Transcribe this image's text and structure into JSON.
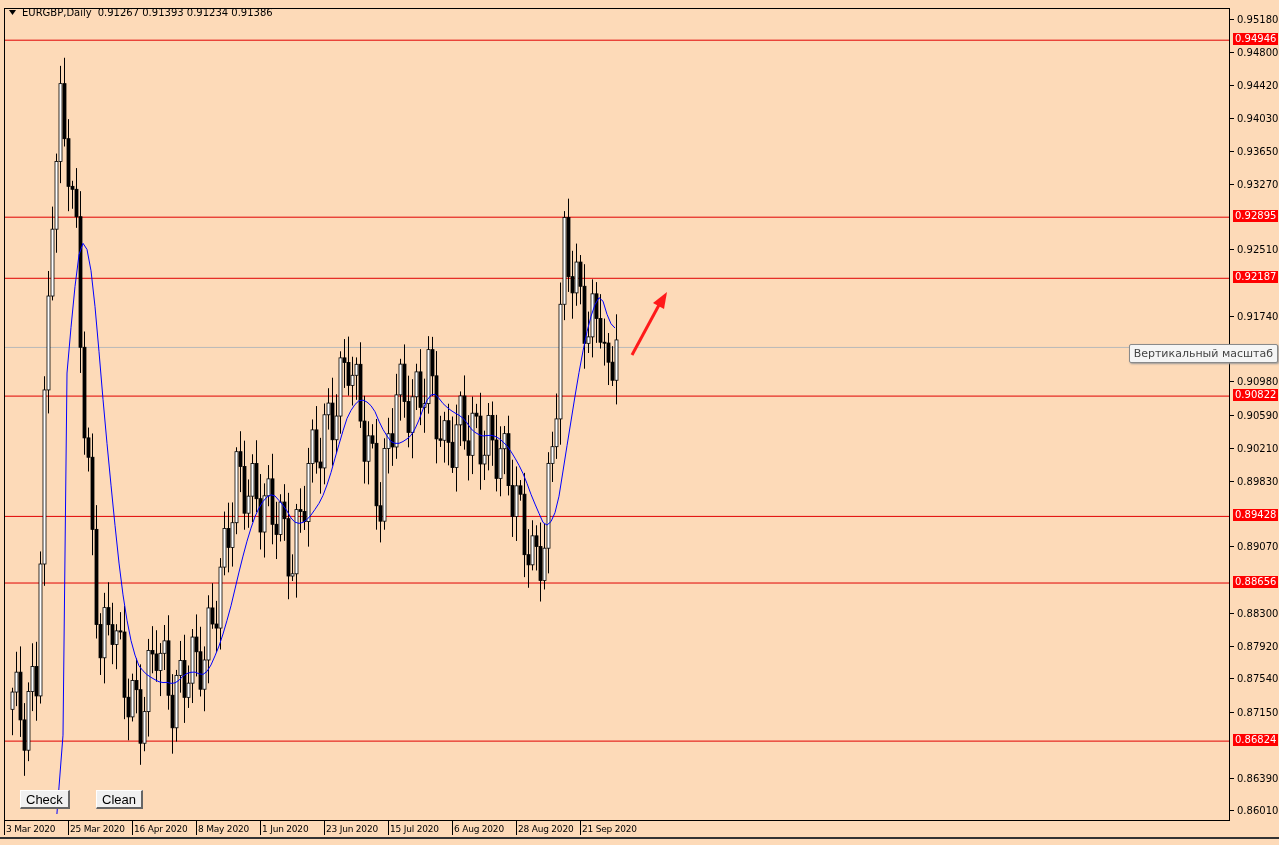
{
  "header": {
    "symbol": "EURGBP,Daily",
    "ohlc": "0.91267 0.91393 0.91234 0.91386"
  },
  "price_axis": {
    "ticks": [
      "0.95180",
      "0.94800",
      "0.94420",
      "0.94030",
      "0.93650",
      "0.93270",
      "0.92510",
      "0.91740",
      "0.90980",
      "0.90590",
      "0.90210",
      "0.89830",
      "0.89070",
      "0.88300",
      "0.87920",
      "0.87540",
      "0.87150",
      "0.86390",
      "0.86010"
    ]
  },
  "levels": [
    {
      "label": "0.94946"
    },
    {
      "label": "0.92895"
    },
    {
      "label": "0.92187"
    },
    {
      "label": "0.90822"
    },
    {
      "label": "0.89428"
    },
    {
      "label": "0.88656"
    },
    {
      "label": "0.86824"
    }
  ],
  "time_axis": {
    "labels": [
      "3 Mar 2020",
      "25 Mar 2020",
      "16 Apr 2020",
      "8 May 2020",
      "1 Jun 2020",
      "23 Jun 2020",
      "15 Jul 2020",
      "6 Aug 2020",
      "28 Aug 2020",
      "21 Sep 2020"
    ]
  },
  "buttons": [
    {
      "label": "Check"
    },
    {
      "label": "Clean"
    }
  ],
  "tooltip": {
    "text": "Вертикальный масштаб"
  }
}
